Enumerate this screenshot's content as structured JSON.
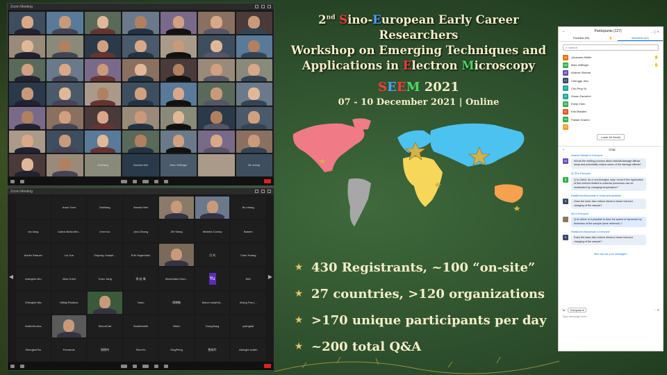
{
  "colors": {
    "gold": "#e3c46a",
    "cream": "#f5eec8",
    "zoom_blue": "#0e71eb",
    "end_red": "#e02020"
  },
  "headline": {
    "sup": "nd",
    "line1": [
      "2",
      "S",
      "ino-",
      "E",
      "uropean Early Career Researchers"
    ],
    "line2": "Workshop on Emerging Techniques and",
    "line3": [
      "Applications in ",
      "E",
      "lectron ",
      "M",
      "icroscopy"
    ]
  },
  "event": {
    "seem_prefix": "SEEM",
    "seem_letters": [
      "S",
      "E",
      "E",
      "M"
    ],
    "year": "2021",
    "dates": "07 - 10 December 2021 | Online"
  },
  "stats": [
    "430 Registrants, ~100 “on-site”",
    "27 countries, >120 organizations",
    ">170 unique participants per day",
    "~200 total Q&A"
  ],
  "top_window": {
    "title": "Zoom Meeting",
    "name_tiles": [
      "DaWang",
      "Xianhui Wei",
      "Marc Willinger",
      "",
      "Bo zhang"
    ]
  },
  "bottom_window": {
    "title": "Zoom Meeting",
    "tiles": [
      "",
      "Aram Yoon",
      "DaWang",
      "Xianhui Wei",
      "",
      "",
      "Bo zhang",
      "xia dong",
      "Carlos Baña Mei...",
      "chen luo",
      "Jurui Zhang",
      "Zhi Wang",
      "Michela Conroy",
      "Basem",
      "Achim Strauch",
      "Lin Yue",
      "Zhiyong Joseph...",
      "Erik Hogerbrink",
      "",
      "月 刘",
      "Chen Huang",
      "changzhi zhu",
      "Alice Kohli",
      "Yuxiu Yang",
      "常 若 倩",
      "Maximilian Goet...",
      "Yu",
      "MAI",
      "Zhengbin Ma",
      "Miltiaj Pissikos",
      "",
      "Yaolu",
      "周晓敏",
      "Mount xulaiHui...",
      "Xining Pan (...",
      "AndrinKovics",
      "",
      "SimonCarl",
      "SaraMontell",
      "WeiLi",
      "DongJiang",
      "yutingdai",
      "ShengboFeu",
      "Fernando",
      "谢建伟",
      "ShenYu",
      "DingPeng",
      "鲍成华",
      "AllAsghi sodeh"
    ],
    "avatar_letters": "Yu"
  },
  "panel": {
    "title": "Participants (127)",
    "tabs": [
      "Panelists (66)",
      "Attendees (61)"
    ],
    "search_placeholder": "Search",
    "participants": [
      {
        "initials": "JM",
        "name": "Johannes Müller",
        "color": "#e6730b",
        "hand": true
      },
      {
        "initials": "MW",
        "name": "Marc Willinger",
        "color": "#2fb34a",
        "hand": true
      },
      {
        "initials": "AS",
        "name": "Andrew Stewart",
        "color": "#6b4fbb",
        "hand": false
      },
      {
        "initials": "CJ",
        "name": "Chengge Jiao",
        "color": "#3a4a6b",
        "hand": false
      },
      {
        "initials": "CY",
        "name": "Chu-Ping Yu",
        "color": "#21a69a",
        "hand": false
      },
      {
        "initials": "SZ",
        "name": "Shuan Zarmehri",
        "color": "#21a69a",
        "hand": false
      },
      {
        "initials": "EM",
        "name": "Emily Chen",
        "color": "#2fb34a",
        "hand": false
      },
      {
        "initials": "SC",
        "name": "Erik Madden",
        "color": "#e3552b",
        "hand": false
      },
      {
        "initials": "EM",
        "name": "Fabian Gramm",
        "color": "#2fb34a",
        "hand": false
      },
      {
        "initials": "FG",
        "name": "",
        "color": "#f0a030",
        "hand": false
      }
    ],
    "lower_hands": "Lower All Hands",
    "chat_title": "Chat",
    "messages": [
      {
        "from": "Andrew Stewart to Everyone",
        "initials": "AS",
        "color": "#6b4fbb",
        "text": "Would the melting process allow radicals/damage diffuse away and potentially reduce some of the damage effects?"
      },
      {
        "from": "月 刘 to Everyone",
        "initials": "月",
        "color": "#2fb34a",
        "text": "Q to Ulrich: As a non-biologist, may I know if the application of this method limited to material processes can be reactivated by changing temperature?"
      },
      {
        "from": "RafalDunin-Borkowski to Hosts and panelists",
        "initials": "R",
        "color": "#3a4a6b",
        "text": "Does the laser also reduce electron beam induced charging of the sample?"
      },
      {
        "from": "Me to Everyone",
        "initials": "",
        "color": "#8a7a5a",
        "text": "Q to Ulrich: is it possible to tune the speed of dynamics by thickness of the sample (heat reservoir) ?"
      },
      {
        "from": "RafalDunin-Borkowski to Everyone",
        "initials": "R",
        "color": "#3a4a6b",
        "text": "Does the laser also reduce electron beam induced charging of the sample?"
      }
    ],
    "who_can_see": "Who can see your messages?",
    "to_label": "To:",
    "to_value": "Everyone ▾",
    "type_placeholder": "Type message here..."
  }
}
